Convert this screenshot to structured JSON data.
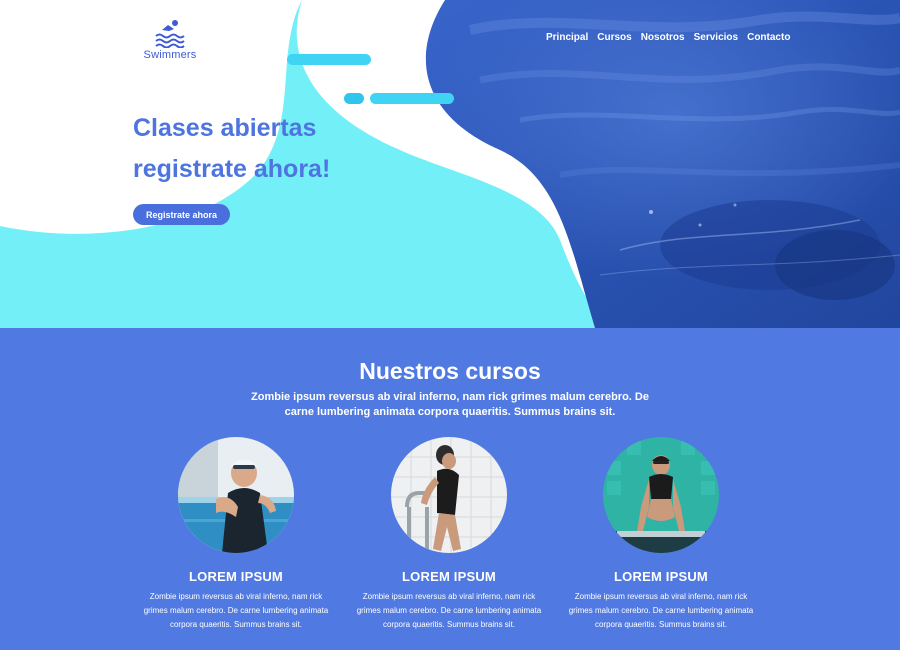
{
  "brand": {
    "name": "Swimmers",
    "logo_icon": "swimmer-waves-icon"
  },
  "nav": {
    "items": [
      "Principal",
      "Cursos",
      "Nosotros",
      "Servicios",
      "Contacto"
    ]
  },
  "hero": {
    "title_line1": "Clases abiertas",
    "title_line2": "registrate ahora!",
    "cta_label": "Registrate ahora"
  },
  "courses": {
    "title": "Nuestros cursos",
    "subtitle": "Zombie ipsum reversus ab viral inferno, nam rick grimes malum cerebro. De carne lumbering animata corpora quaeritis. Summus brains sit.",
    "cards": [
      {
        "title": "LOREM IPSUM",
        "text": "Zombie ipsum reversus ab viral inferno, nam rick grimes malum cerebro. De carne lumbering animata corpora quaeritis. Summus brains sit.",
        "photo": "swimmer-at-pool-edge"
      },
      {
        "title": "LOREM IPSUM",
        "text": "Zombie ipsum reversus ab viral inferno, nam rick grimes malum cerebro. De carne lumbering animata corpora quaeritis. Summus brains sit.",
        "photo": "swimmer-on-pool-ladder"
      },
      {
        "title": "LOREM IPSUM",
        "text": "Zombie ipsum reversus ab viral inferno, nam rick grimes malum cerebro. De carne lumbering animata corpora quaeritis. Summus brains sit.",
        "photo": "swimmer-on-starting-block"
      }
    ]
  },
  "colors": {
    "accent": "#4d74df",
    "section_bg": "#5079e1",
    "cyan": "#73f0f7",
    "pool_blue": "#2a56b8"
  }
}
